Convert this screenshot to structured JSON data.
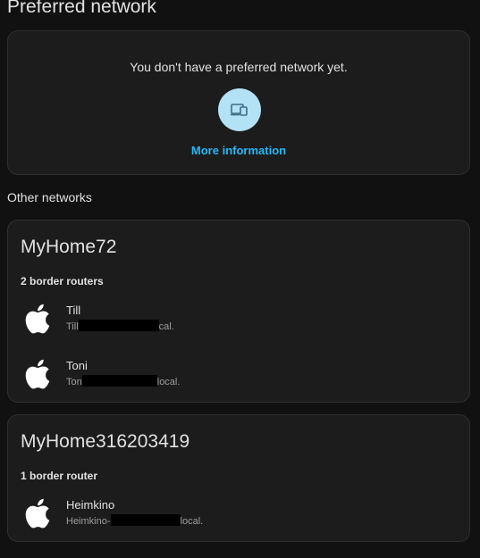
{
  "preferred": {
    "title": "Preferred network",
    "empty_text": "You don't have a preferred network yet.",
    "icon": "devices-icon",
    "more_info_label": "More information"
  },
  "other": {
    "title": "Other networks"
  },
  "networks": [
    {
      "name": "MyHome72",
      "router_count": "2 border routers",
      "routers": [
        {
          "name": "Till",
          "host_prefix": "Till",
          "host_suffix": "cal.",
          "icon": "apple-icon"
        },
        {
          "name": "Toni",
          "host_prefix": "Ton",
          "host_suffix": "local.",
          "icon": "apple-icon"
        }
      ]
    },
    {
      "name": "MyHome316203419",
      "router_count": "1 border router",
      "routers": [
        {
          "name": "Heimkino",
          "host_prefix": "Heimkino-",
          "host_suffix": "local.",
          "icon": "apple-icon"
        }
      ]
    }
  ],
  "colors": {
    "background": "#111111",
    "card": "#1c1c1c",
    "accent": "#29b6f6",
    "icon_circle": "#b3e1f6"
  }
}
